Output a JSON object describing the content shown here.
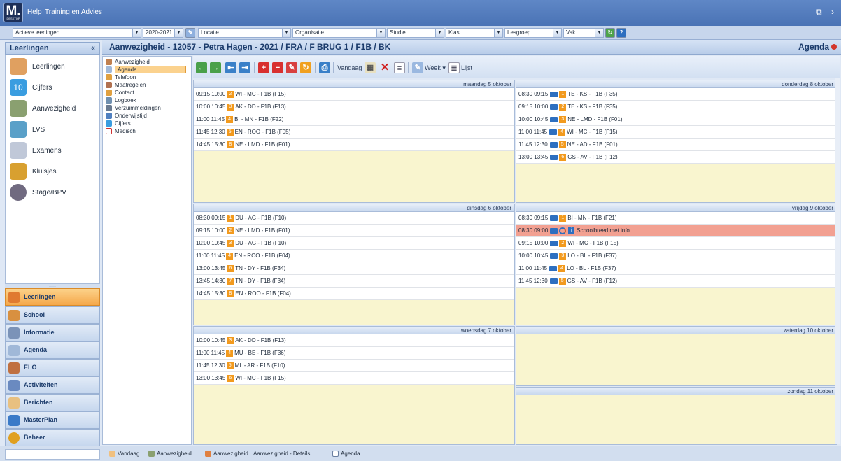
{
  "app": {
    "logo": "M.",
    "logo_sub": "DESKTOP",
    "menu": [
      "Help",
      "Training en Advies"
    ]
  },
  "filters": {
    "leerlingen": "Actieve leerlingen",
    "jaar": "2020-2021",
    "locatie": "Locatie...",
    "organisatie": "Organisatie...",
    "studie": "Studie...",
    "klas": "Klas...",
    "lesgroep": "Lesgroep...",
    "vak": "Vak..."
  },
  "left": {
    "header": "Leerlingen",
    "items": [
      "Leerlingen",
      "Cijfers",
      "Aanwezigheid",
      "LVS",
      "Examens",
      "Kluisjes",
      "Stage/BPV"
    ],
    "nav": [
      "Leerlingen",
      "School",
      "Informatie",
      "Agenda",
      "ELO",
      "Activiteiten",
      "Berichten",
      "MasterPlan",
      "Beheer"
    ]
  },
  "main": {
    "title": "Aanwezigheid - 12057 - Petra Hagen - 2021 / FRA / F BRUG 1 / F1B / BK",
    "right_label": "Agenda"
  },
  "tree": [
    "Aanwezigheid",
    "Agenda",
    "Telefoon",
    "Maatregelen",
    "Contact",
    "Logboek",
    "Verzuimmeldingen",
    "Onderwijstijd",
    "Cijfers",
    "Medisch"
  ],
  "toolbar": {
    "vandaag": "Vandaag",
    "week": "Week",
    "lijst": "Lijst"
  },
  "days": {
    "maandag": {
      "label": "maandag 5 oktober",
      "lessons": [
        {
          "time": "09:15 10:00",
          "uur": "2",
          "text": "WI - MC - F1B (F15)"
        },
        {
          "time": "10:00 10:45",
          "uur": "3",
          "text": "AK - DD - F1B (F13)"
        },
        {
          "time": "11:00 11:45",
          "uur": "4",
          "text": "BI - MN - F1B (F22)"
        },
        {
          "time": "11:45 12:30",
          "uur": "5",
          "text": "EN - ROO - F1B (F05)"
        },
        {
          "time": "14:45 15:30",
          "uur": "8",
          "text": "NE - LMD - F1B (F01)"
        }
      ]
    },
    "dinsdag": {
      "label": "dinsdag 6 oktober",
      "lessons": [
        {
          "time": "08:30 09:15",
          "uur": "1",
          "text": "DU - AG - F1B (F10)"
        },
        {
          "time": "09:15 10:00",
          "uur": "2",
          "text": "NE - LMD - F1B (F01)"
        },
        {
          "time": "10:00 10:45",
          "uur": "3",
          "text": "DU - AG - F1B (F10)"
        },
        {
          "time": "11:00 11:45",
          "uur": "4",
          "text": "EN - ROO - F1B (F04)"
        },
        {
          "time": "13:00 13:45",
          "uur": "6",
          "text": "TN - DY - F1B (F34)"
        },
        {
          "time": "13:45 14:30",
          "uur": "7",
          "text": "TN - DY - F1B (F34)"
        },
        {
          "time": "14:45 15:30",
          "uur": "8",
          "text": "EN - ROO - F1B (F04)"
        }
      ]
    },
    "woensdag": {
      "label": "woensdag 7 oktober",
      "lessons": [
        {
          "time": "10:00 10:45",
          "uur": "3",
          "text": "AK - DD - F1B (F13)"
        },
        {
          "time": "11:00 11:45",
          "uur": "4",
          "text": "MU - BE - F1B (F36)"
        },
        {
          "time": "11:45 12:30",
          "uur": "5",
          "text": "ML - AR - F1B (F10)"
        },
        {
          "time": "13:00 13:45",
          "uur": "6",
          "text": "WI - MC - F1B (F15)"
        }
      ]
    },
    "donderdag": {
      "label": "donderdag 8 oktober",
      "lessons": [
        {
          "time": "08:30 09:15",
          "uur": "1",
          "text": "TE - KS - F1B (F35)"
        },
        {
          "time": "09:15 10:00",
          "uur": "2",
          "text": "TE - KS - F1B (F35)"
        },
        {
          "time": "10:00 10:45",
          "uur": "3",
          "text": "NE - LMD - F1B (F01)"
        },
        {
          "time": "11:00 11:45",
          "uur": "4",
          "text": "WI - MC - F1B (F15)"
        },
        {
          "time": "11:45 12:30",
          "uur": "5",
          "text": "NE - AD - F1B (F01)"
        },
        {
          "time": "13:00 13:45",
          "uur": "6",
          "text": "GS - AV - F1B (F12)"
        }
      ]
    },
    "vrijdag": {
      "label": "vrijdag 9 oktober",
      "lessons": [
        {
          "time": "08:30 09:15",
          "uur": "1",
          "text": "BI - MN - F1B (F21)"
        },
        {
          "time": "08:30 09:00",
          "uur": "",
          "text": "Schoolbreed met info",
          "highlight": true
        },
        {
          "time": "09:15 10:00",
          "uur": "2",
          "text": "WI - MC - F1B (F15)"
        },
        {
          "time": "10:00 10:45",
          "uur": "3",
          "text": "LO - BL - F1B (F37)"
        },
        {
          "time": "11:00 11:45",
          "uur": "4",
          "text": "LO - BL - F1B (F37)"
        },
        {
          "time": "11:45 12:30",
          "uur": "5",
          "text": "GS - AV - F1B (F12)"
        }
      ]
    },
    "zaterdag": {
      "label": "zaterdag 10 oktober"
    },
    "zondag": {
      "label": "zondag 11 oktober"
    }
  },
  "statusbar": [
    "Vandaag",
    "Aanwezigheid",
    "Aanwezigheid",
    "Aanwezigheid - Details",
    "Agenda"
  ]
}
